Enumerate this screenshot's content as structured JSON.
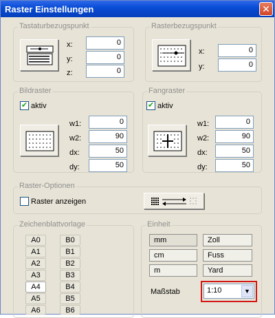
{
  "window": {
    "title": "Raster Einstellungen",
    "close": "✕"
  },
  "tastatur": {
    "legend": "Tastaturbezugspunkt",
    "fields": [
      {
        "label": "x:",
        "value": "0"
      },
      {
        "label": "y:",
        "value": "0"
      },
      {
        "label": "z:",
        "value": "0"
      }
    ]
  },
  "rasterbezug": {
    "legend": "Rasterbezugspunkt",
    "fields": [
      {
        "label": "x:",
        "value": "0"
      },
      {
        "label": "y:",
        "value": "0"
      }
    ]
  },
  "bildraster": {
    "legend": "Bildraster",
    "aktiv_label": "aktiv",
    "aktiv_checked": true,
    "fields": [
      {
        "label": "w1:",
        "value": "0"
      },
      {
        "label": "w2:",
        "value": "90"
      },
      {
        "label": "dx:",
        "value": "50"
      },
      {
        "label": "dy:",
        "value": "50"
      }
    ]
  },
  "fangraster": {
    "legend": "Fangraster",
    "aktiv_label": "aktiv",
    "aktiv_checked": true,
    "fields": [
      {
        "label": "w1:",
        "value": "0"
      },
      {
        "label": "w2:",
        "value": "90"
      },
      {
        "label": "dx:",
        "value": "50"
      },
      {
        "label": "dy:",
        "value": "50"
      }
    ]
  },
  "optionen": {
    "legend": "Raster-Optionen",
    "anzeigen_label": "Raster anzeigen",
    "anzeigen_checked": false
  },
  "vorlage": {
    "legend": "Zeichenblattvorlage",
    "a_sizes": [
      "A0",
      "A1",
      "A2",
      "A3",
      "A4",
      "A5",
      "A6"
    ],
    "b_sizes": [
      "B0",
      "B1",
      "B2",
      "B3",
      "B4",
      "B5",
      "B6"
    ],
    "selected": "A4"
  },
  "einheit": {
    "legend": "Einheit",
    "units": [
      [
        "mm",
        "Zoll"
      ],
      [
        "cm",
        "Fuss"
      ],
      [
        "m",
        "Yard"
      ]
    ],
    "selected": "mm",
    "massstab_label": "Maßstab",
    "massstab_value": "1:10"
  },
  "colors": {
    "titlebar": "#0a4ed7",
    "highlight": "#d41616",
    "check": "#21a121"
  }
}
